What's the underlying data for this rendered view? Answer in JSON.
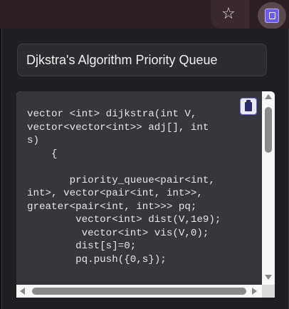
{
  "toolbar": {
    "bookmark_icon": "star-outline-icon",
    "extension_icon": "extension-icon",
    "star_glyph": "☆"
  },
  "popup": {
    "title": "Djkstra's Algorithm Priority Queue",
    "code": "vector <int> dijkstra(int V,\nvector<vector<int>> adj[], int\ns)\n    {\n\n       priority_queue<pair<int,\nint>, vector<pair<int, int>>,\ngreater<pair<int, int>>> pq;\n        vector<int> dist(V,1e9);\n         vector<int> vis(V,0);\n        dist[s]=0;\n        pq.push({0,s});",
    "copy_icon": "clipboard-icon"
  },
  "colors": {
    "page_bg": "#1f1f22",
    "code_bg": "#36373c",
    "code_text": "#e6e6e6",
    "accent": "#6b5cf0"
  }
}
